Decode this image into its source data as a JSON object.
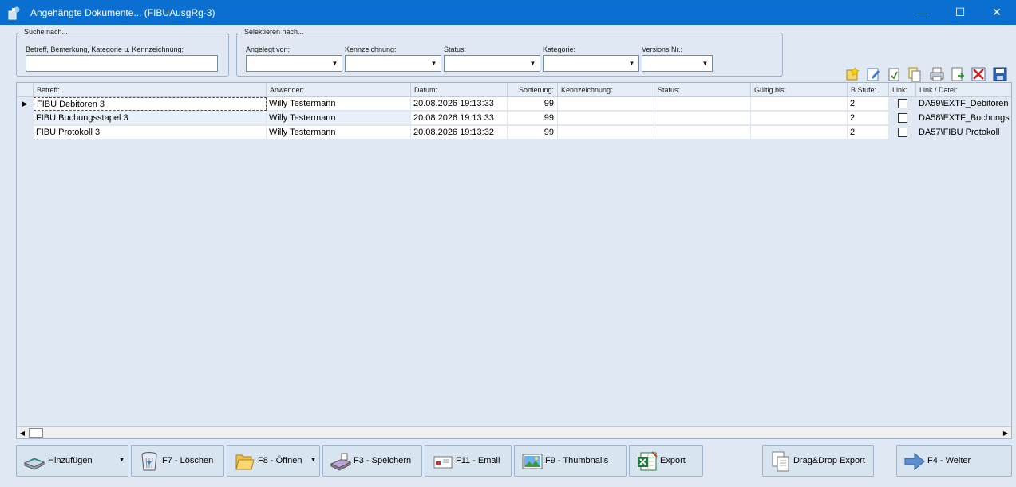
{
  "window": {
    "title": "Angehängte Dokumente... (FIBUAusgRg-3)",
    "minimize_glyph": "—",
    "maximize_glyph": "☐",
    "close_glyph": "✕"
  },
  "search": {
    "group_title": "Suche nach...",
    "label": "Betreff, Bemerkung, Kategorie u. Kennzeichnung:",
    "value": ""
  },
  "filter": {
    "group_title": "Selektieren nach...",
    "fields": [
      {
        "label": "Angelegt von:",
        "value": ""
      },
      {
        "label": "Kennzeichnung:",
        "value": ""
      },
      {
        "label": "Status:",
        "value": ""
      },
      {
        "label": "Kategorie:",
        "value": ""
      },
      {
        "label": "Versions Nr.:",
        "value": ""
      }
    ]
  },
  "toolbar": {
    "icons": [
      "new-document-icon",
      "edit-icon",
      "attach-icon",
      "copy-icon",
      "print-icon",
      "export-icon",
      "delete-icon",
      "save-icon"
    ]
  },
  "grid": {
    "columns": [
      "Betreff:",
      "Anwender:",
      "Datum:",
      "Sortierung:",
      "Kennzeichnung:",
      "Status:",
      "Gültig bis:",
      "B.Stufe:",
      "Link:",
      "Link / Datei:"
    ],
    "rows": [
      {
        "betreff": "FIBU Debitoren 3",
        "anwender": "Willy Testermann",
        "datum": "20.08.2026 19:13:33",
        "sortierung": "99",
        "kennzeichnung": "",
        "status": "",
        "gueltig": "",
        "bstufe": "2",
        "link": false,
        "datei": "DA59\\EXTF_Debitoren"
      },
      {
        "betreff": "FIBU Buchungsstapel 3",
        "anwender": "Willy Testermann",
        "datum": "20.08.2026 19:13:33",
        "sortierung": "99",
        "kennzeichnung": "",
        "status": "",
        "gueltig": "",
        "bstufe": "2",
        "link": false,
        "datei": "DA58\\EXTF_Buchungs"
      },
      {
        "betreff": "FIBU Protokoll 3",
        "anwender": "Willy Testermann",
        "datum": "20.08.2026 19:13:32",
        "sortierung": "99",
        "kennzeichnung": "",
        "status": "",
        "gueltig": "",
        "bstufe": "2",
        "link": false,
        "datei": "DA57\\FIBU Protokoll"
      }
    ]
  },
  "buttons": {
    "add": "Hinzufügen",
    "delete": "F7 - Löschen",
    "open": "F8 - Öffnen",
    "save": "F3 - Speichern",
    "email": "F11 - Email",
    "thumbnails": "F9 - Thumbnails",
    "export": "Export",
    "dragdrop": "Drag&Drop Export",
    "next": "F4 - Weiter"
  },
  "colors": {
    "titlebar": "#0a6fd1",
    "background": "#dfe8f3"
  }
}
